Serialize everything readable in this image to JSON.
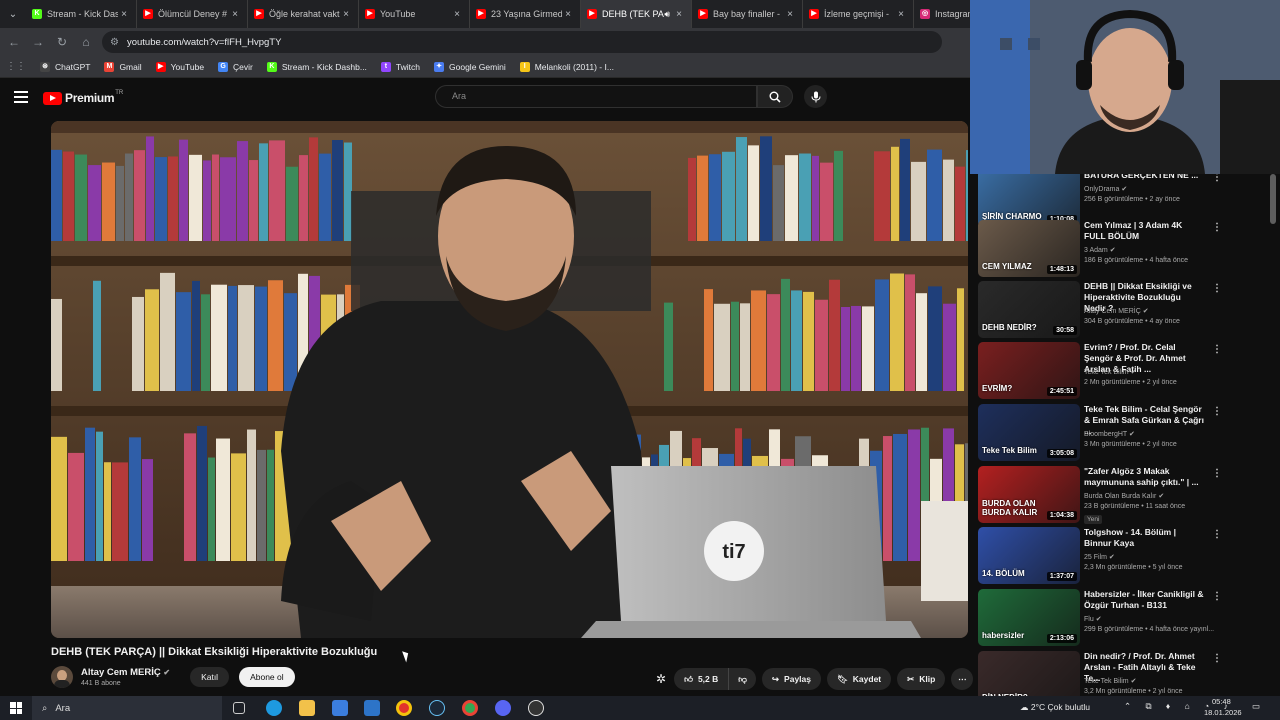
{
  "browser": {
    "tabs": [
      {
        "title": "Stream - Kick Dash",
        "color": "#53fc18",
        "glyph": "K",
        "active": false
      },
      {
        "title": "Ölümcül Deney #",
        "color": "#ff0000",
        "glyph": "▶",
        "active": false
      },
      {
        "title": "Öğle kerahat vakti",
        "color": "#ff0000",
        "glyph": "▶",
        "active": false
      },
      {
        "title": "YouTube",
        "color": "#ff0000",
        "glyph": "▶",
        "active": false
      },
      {
        "title": "23 Yaşına Girmeden",
        "color": "#ff0000",
        "glyph": "▶",
        "active": false
      },
      {
        "title": "DEHB (TEK PA",
        "color": "#ff0000",
        "glyph": "▶",
        "active": true
      },
      {
        "title": "Bay bay finaller -",
        "color": "#ff0000",
        "glyph": "▶",
        "active": false
      },
      {
        "title": "İzleme geçmişi -",
        "color": "#ff0000",
        "glyph": "▶",
        "active": false
      },
      {
        "title": "Instagram",
        "color": "#d62976",
        "glyph": "◎",
        "active": false
      }
    ],
    "url": "youtube.com/watch?v=flFH_HvpgTY",
    "bookmarks": [
      {
        "label": "ChatGPT",
        "color": "#444",
        "glyph": "⊛"
      },
      {
        "label": "Gmail",
        "color": "#ea4335",
        "glyph": "M"
      },
      {
        "label": "YouTube",
        "color": "#ff0000",
        "glyph": "▶"
      },
      {
        "label": "Çevir",
        "color": "#4285f4",
        "glyph": "G"
      },
      {
        "label": "Stream - Kick Dashb...",
        "color": "#53fc18",
        "glyph": "K"
      },
      {
        "label": "Twitch",
        "color": "#9146ff",
        "glyph": "t"
      },
      {
        "label": "Google Gemini",
        "color": "#4a7cf0",
        "glyph": "✦"
      },
      {
        "label": "Melankoli (2011) - I...",
        "color": "#f5c518",
        "glyph": "I"
      }
    ]
  },
  "yt": {
    "logo_text": "Premium",
    "region": "TR",
    "search_placeholder": "Ara",
    "video_title": "DEHB (TEK PARÇA) || Dikkat Eksikliği Hiperaktivite Bozukluğu",
    "channel_name": "Altay Cem MERİÇ",
    "subscribers": "441 B abone",
    "join_label": "Katıl",
    "subscribe_label": "Abone ol",
    "likes": "5,2 B",
    "share_label": "Paylaş",
    "save_label": "Kaydet",
    "clip_label": "Klip",
    "logo_on_laptop": "ti7"
  },
  "sidebar": [
    {
      "title": "BATURA GERÇEKTEN NE ...",
      "channel": "OnlyDrama",
      "meta": "256 B görüntüleme • 2 ay önce",
      "duration": "1:10:08",
      "thumb": "#3a6ea5",
      "caption": "ŞİRİN CHARMO"
    },
    {
      "title": "Cem Yılmaz | 3 Adam 4K FULL BÖLÜM",
      "channel": "3 Adam",
      "meta": "186 B görüntüleme • 4 hafta önce",
      "duration": "1:48:13",
      "thumb": "#6b5a4a",
      "caption": "CEM YILMAZ"
    },
    {
      "title": "DEHB || Dikkat Eksikliği ve Hiperaktivite Bozukluğu Nedir ?",
      "channel": "Altay Cem MERİÇ",
      "meta": "304 B görüntüleme • 4 ay önce",
      "duration": "30:58",
      "thumb": "#2a2a2a",
      "caption": "DEHB NEDİR?"
    },
    {
      "title": "Evrim? / Prof. Dr. Celal Şengör & Prof. Dr. Ahmet Arslan & Fatih ...",
      "channel": "Teke Tek Bilim",
      "meta": "2 Mn görüntüleme • 2 yıl önce",
      "duration": "2:45:51",
      "thumb": "#7a1f1f",
      "caption": "EVRİM?"
    },
    {
      "title": "Teke Tek Bilim - Celal Şengör & Emrah Safa Gürkan & Çağrı ...",
      "channel": "BloombergHT",
      "meta": "3 Mn görüntüleme • 2 yıl önce",
      "duration": "3:05:08",
      "thumb": "#1e2f5c",
      "caption": "Teke Tek Bilim"
    },
    {
      "title": "\"Zafer Algöz 3 Makak maymununa sahip çıktı.\" | ...",
      "channel": "Burda Olan Burda Kalır",
      "meta": "23 B görüntüleme • 11 saat önce",
      "duration": "1:04:38",
      "thumb": "#b32020",
      "caption": "BURDA OLAN BURDA KALIR",
      "badge": "Yeni"
    },
    {
      "title": "Tolgshow - 14. Bölüm | Binnur Kaya",
      "channel": "25 Film",
      "meta": "2,3 Mn görüntüleme • 5 yıl önce",
      "duration": "1:37:07",
      "thumb": "#2f4fa8",
      "caption": "14. BÖLÜM"
    },
    {
      "title": "Habersizler - İlker Canikligil & Özgür Turhan - B131",
      "channel": "Flu",
      "meta": "299 B görüntüleme • 4 hafta önce yayınl...",
      "duration": "2:13:06",
      "thumb": "#1f6b3a",
      "caption": "habersizler"
    },
    {
      "title": "Din nedir? / Prof. Dr. Ahmet Arslan - Fatih Altaylı & Teke Te...",
      "channel": "Teke Tek Bilim",
      "meta": "3,2 Mn görüntüleme • 2 yıl önce",
      "duration": "",
      "thumb": "#3a2a2a",
      "caption": "DİN NEDİR?"
    }
  ],
  "taskbar": {
    "search_label": "Ara",
    "weather": "2°C  Çok bulutlu",
    "time": "05:48",
    "date": "18.01.2026"
  },
  "colors": {
    "accent": "#ff0000",
    "bg": "#0f0f0f",
    "chip": "#272727"
  }
}
